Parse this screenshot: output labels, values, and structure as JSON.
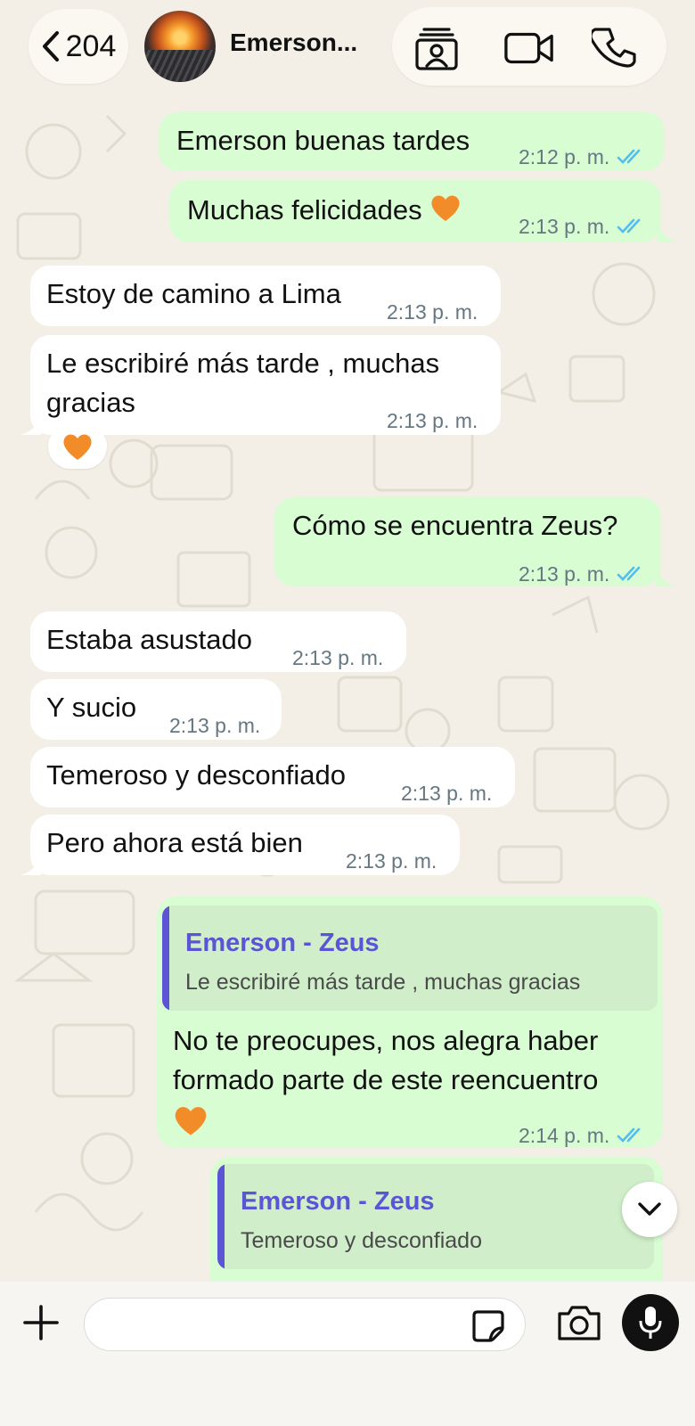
{
  "header": {
    "unread_count": "204",
    "contact_name": "Emerson..."
  },
  "messages": [
    {
      "text": "Emerson buenas tardes",
      "time": "2:12 p. m."
    },
    {
      "text": "Muchas felicidades",
      "time": "2:13 p. m."
    },
    {
      "text": "Estoy de camino a Lima",
      "time": "2:13 p. m."
    },
    {
      "line1": "Le escribiré más tarde , muchas",
      "line2": "gracias",
      "time": "2:13 p. m."
    },
    {
      "text": "Cómo se encuentra Zeus?",
      "time": "2:13 p. m."
    },
    {
      "text": "Estaba asustado",
      "time": "2:13 p. m."
    },
    {
      "text": "Y sucio",
      "time": "2:13 p. m."
    },
    {
      "text": "Temeroso y desconfiado",
      "time": "2:13 p. m."
    },
    {
      "text": "Pero ahora está bien",
      "time": "2:13 p. m."
    },
    {
      "quote_author": "Emerson - Zeus",
      "quote_text": "Le escribiré más tarde , muchas gracias",
      "line1": "No te preocupes, nos alegra haber",
      "line2": "formado parte de este reencuentro",
      "time": "2:14 p. m."
    },
    {
      "quote_author": "Emerson - Zeus",
      "quote_text": "Temeroso y desconfiado"
    }
  ],
  "composer": {
    "placeholder": ""
  },
  "colors": {
    "outgoing_bubble": "#d9fdd3",
    "incoming_bubble": "#ffffff",
    "quote_accent": "#5b55d6",
    "read_ticks": "#53bdeb",
    "reaction": "#f28c28"
  },
  "icons": [
    "chevron-left-icon",
    "contact-card-icon",
    "video-call-icon",
    "phone-icon",
    "double-check-icon",
    "orange-heart-icon",
    "chevron-down-icon",
    "plus-icon",
    "sticker-icon",
    "camera-icon",
    "microphone-icon"
  ]
}
